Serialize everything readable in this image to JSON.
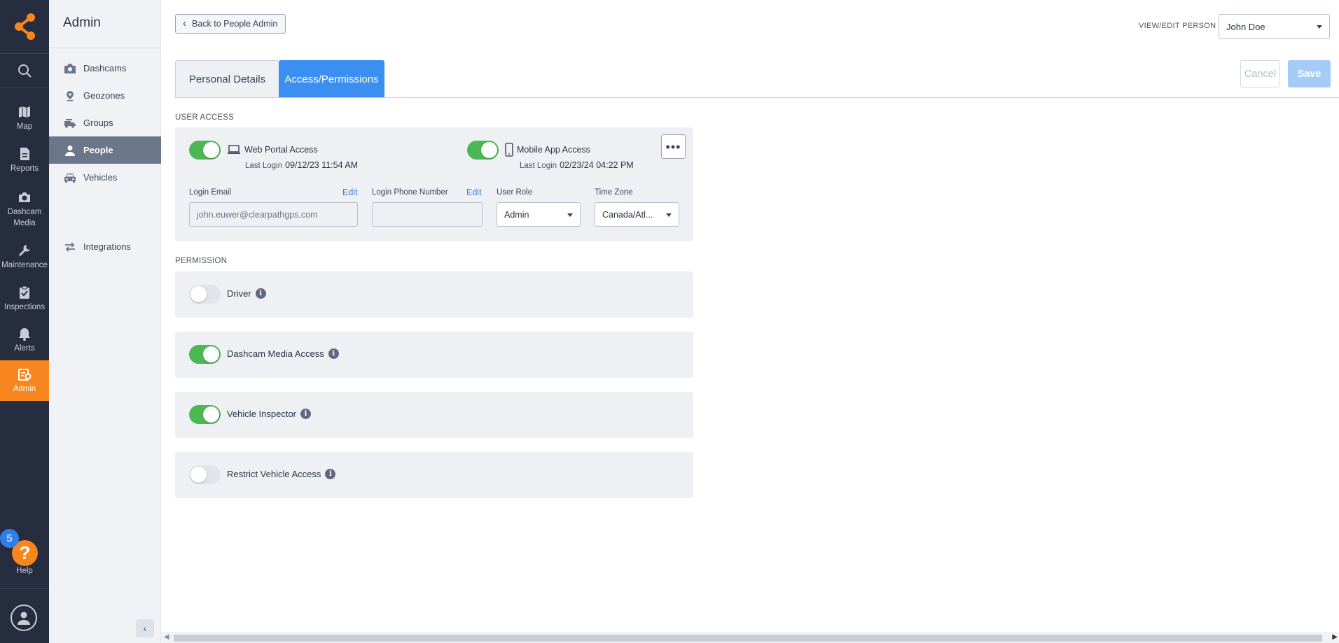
{
  "rail": {
    "items": [
      {
        "icon": "search-icon",
        "label": ""
      },
      {
        "icon": "map-icon",
        "label": "Map"
      },
      {
        "icon": "reports-icon",
        "label": "Reports"
      },
      {
        "icon": "camera-icon",
        "label": "Dashcam Media"
      },
      {
        "icon": "wrench-icon",
        "label": "Maintenance"
      },
      {
        "icon": "clipboard-icon",
        "label": "Inspections"
      },
      {
        "icon": "bell-icon",
        "label": "Alerts"
      },
      {
        "icon": "admin-icon",
        "label": "Admin"
      }
    ],
    "help_badge": "5",
    "help_label": "Help",
    "accent_color": "#f7861e"
  },
  "sidebar": {
    "title": "Admin",
    "items": [
      {
        "icon": "camera-icon",
        "label": "Dashcams"
      },
      {
        "icon": "location-pin-icon",
        "label": "Geozones"
      },
      {
        "icon": "truck-group-icon",
        "label": "Groups"
      },
      {
        "icon": "person-icon",
        "label": "People",
        "active": true
      },
      {
        "icon": "car-icon",
        "label": "Vehicles"
      },
      {
        "icon": "arrows-exchange-icon",
        "label": "Integrations"
      }
    ]
  },
  "header": {
    "back_label": "Back to People Admin",
    "view_edit_label": "VIEW/EDIT PERSON",
    "person_selected": "John Doe",
    "cancel_label": "Cancel",
    "save_label": "Save"
  },
  "tabs": [
    {
      "label": "Personal Details",
      "active": false
    },
    {
      "label": "Access/Permissions",
      "active": true
    }
  ],
  "user_access": {
    "section_label": "USER ACCESS",
    "web_portal": {
      "label": "Web Portal Access",
      "enabled": true,
      "last_login_label": "Last Login",
      "last_login": "09/12/23 11:54 AM"
    },
    "mobile_app": {
      "label": "Mobile App Access",
      "enabled": true,
      "last_login_label": "Last Login",
      "last_login": "02/23/24 04:22 PM"
    },
    "more_label": "•••",
    "login_email": {
      "label": "Login Email",
      "edit": "Edit",
      "value": "john.euwer@clearpathgps.com"
    },
    "login_phone": {
      "label": "Login Phone Number",
      "edit": "Edit",
      "value": ""
    },
    "user_role": {
      "label": "User Role",
      "value": "Admin"
    },
    "time_zone": {
      "label": "Time Zone",
      "value": "Canada/Atl..."
    }
  },
  "permissions": {
    "section_label": "PERMISSION",
    "items": [
      {
        "label": "Driver",
        "enabled": false
      },
      {
        "label": "Dashcam Media Access",
        "enabled": true
      },
      {
        "label": "Vehicle Inspector",
        "enabled": true
      },
      {
        "label": "Restrict Vehicle Access",
        "enabled": false
      }
    ]
  },
  "colors": {
    "primary": "#3b8ff0",
    "toggle_on": "#4cb853",
    "rail_bg": "#262d3f"
  }
}
